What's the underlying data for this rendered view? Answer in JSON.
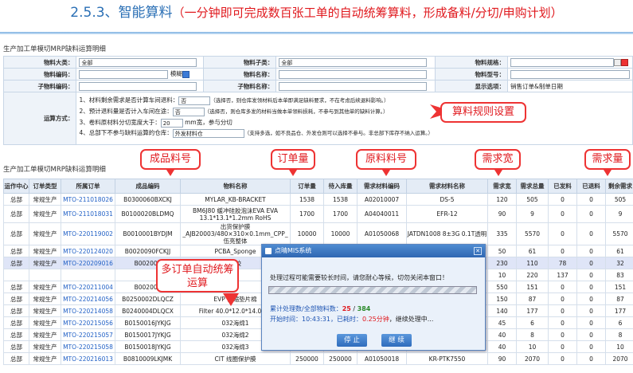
{
  "title": {
    "number": "2.5.3、",
    "main": "智能算料",
    "sub": "（一分钟即可完成数百张工单的自动统筹算料，形成备料/分切/申购计划）"
  },
  "section1_title": "生产加工单模切MRP缺料运算明细",
  "form": {
    "row1": {
      "l1": "物料大类：",
      "v1": "全部",
      "l2": "物料子类：",
      "v2": "全部",
      "l3": "物料规格："
    },
    "row2": {
      "l1": "物料编码：",
      "fuzzy": "模糊",
      "l2": "物料名称：",
      "l3": "物料型号："
    },
    "row3": {
      "l1": "子物料编码：",
      "l2": "子物料名称：",
      "l3": "显示选项：",
      "v3": "销售订单&制单日期"
    }
  },
  "rules": {
    "label": "运算方式：",
    "r1a": "1、材料剩余需求是否计算车间退料：",
    "r1v": "否",
    "r1b": "（选择否，则仓库发领材料后本单即满足缺料要求，不在考虑后续退料影响。）",
    "r2a": "2、预计退料量是否计入车间在途：",
    "r2v": "否",
    "r2b": "（选择否，则仓库多发的材料当做本单领料损耗，不参与到其他单的缺料计算。）",
    "r3a": "3、卷料原材料分切宽度大于：",
    "r3v": "20",
    "r3b": "mm宽，参与分切",
    "r4a": "4、总部下不参与缺料运算的仓库：",
    "r4v": "外发材料仓",
    "r4b": "（支持多选，如不良品仓、外发仓则可以选择不参与。非总部下库存不纳入运算。）"
  },
  "section2_title": "生产加工单模切MRP缺料运算明细",
  "columns": [
    "运作中心",
    "订单类型",
    "所属订单",
    "成品编码",
    "物料名称",
    "订单量",
    "待入库量",
    "需求材料编码",
    "需求材料名称",
    "需求宽",
    "需求总量",
    "已发料",
    "已退料",
    "剩余需求"
  ],
  "rows": [
    [
      "总部",
      "常规生产",
      "MTO-211018026",
      "B0300060BXCKJ",
      "MYLAR_KB-BRACKET",
      "1538",
      "1538",
      "A02010007",
      "DS-5",
      "120",
      "505",
      "0",
      "0",
      "505"
    ],
    [
      "总部",
      "常规生产",
      "MTO-211018031",
      "B0100020BLDMQ",
      "BM6J80 缓冲硅胶泡沫EVA EVA 13.1*13.1*1.2mm RoHS",
      "1700",
      "1700",
      "A04040011",
      "EFR-12",
      "90",
      "9",
      "0",
      "0",
      "9"
    ],
    [
      "总部",
      "常规生产",
      "MTO-220119002",
      "B0010001BYDJM",
      "出货保护膜_AJB20003/480×310×0.1mm_CPP_伍亮整体",
      "10000",
      "10000",
      "A01050068",
      "JATDN1008 8±3G 0.1T透明",
      "335",
      "5570",
      "0",
      "0",
      "5570"
    ],
    [
      "总部",
      "常规生产",
      "MTO-220124020",
      "B0020090FCKJJ",
      "PCBA_Sponge",
      "50",
      "50",
      "",
      "",
      "50",
      "61",
      "0",
      "0",
      "61"
    ],
    [
      "总部",
      "常规生产",
      "MTO-220209016",
      "B002007",
      "背胶",
      "",
      "",
      "",
      "",
      "230",
      "110",
      "78",
      "0",
      "32"
    ],
    [
      "",
      "",
      "",
      "",
      "",
      "",
      "",
      "",
      "",
      "10",
      "220",
      "137",
      "0",
      "83"
    ],
    [
      "总部",
      "常规生产",
      "MTO-220211004",
      "B002005",
      "",
      "",
      "",
      "",
      "",
      "550",
      "151",
      "0",
      "0",
      "151"
    ],
    [
      "总部",
      "常规生产",
      "MTO-220214056",
      "B0250002DLQCZ",
      "EVP 伸缩垫片棉",
      "",
      "",
      "",
      "",
      "150",
      "87",
      "0",
      "0",
      "87"
    ],
    [
      "总部",
      "常规生产",
      "MTO-220214058",
      "B0240004DLQCX",
      "Filter 40.0*12.0*14.0MM",
      "",
      "",
      "",
      "",
      "140",
      "177",
      "0",
      "0",
      "177"
    ],
    [
      "总部",
      "常规生产",
      "MTO-220215056",
      "B0150016JYKJG",
      "032海绵1",
      "",
      "",
      "",
      "",
      "45",
      "6",
      "0",
      "0",
      "6"
    ],
    [
      "总部",
      "常规生产",
      "MTO-220215057",
      "B0150017JYKJG",
      "032海绵2",
      "",
      "",
      "",
      "",
      "40",
      "8",
      "0",
      "0",
      "8"
    ],
    [
      "总部",
      "常规生产",
      "MTO-220215058",
      "B0150018JYKJG",
      "032海绵3",
      "",
      "",
      "",
      "",
      "40",
      "10",
      "0",
      "0",
      "10"
    ],
    [
      "总部",
      "常规生产",
      "MTO-220216013",
      "B0810009LKJMK",
      "CIT 线圈保护膜",
      "250000",
      "250000",
      "A01050018",
      "KR-PTK7550",
      "90",
      "2070",
      "0",
      "0",
      "2070"
    ]
  ],
  "callouts": {
    "rule": "算料规则设置",
    "product": "成品料号",
    "order_qty": "订单量",
    "material": "原料料号",
    "width": "需求宽",
    "demand": "需求量",
    "multi": "多订单自动统筹运算"
  },
  "dialog": {
    "title": "点晴MIS系统",
    "message": "处理过程可能需要较长时间，请您耐心等候，切勿关闭本窗口！",
    "progress_label": "累计处理数/全部物料数：",
    "done": "25",
    "total": "384",
    "start_label": "开始时间：",
    "start_time": "10:43:31",
    "elapsed_label": "，已耗时：",
    "elapsed": "0.25分钟",
    "tail": "，继续处理中...",
    "pause": "停 止",
    "continue": "继 续"
  }
}
